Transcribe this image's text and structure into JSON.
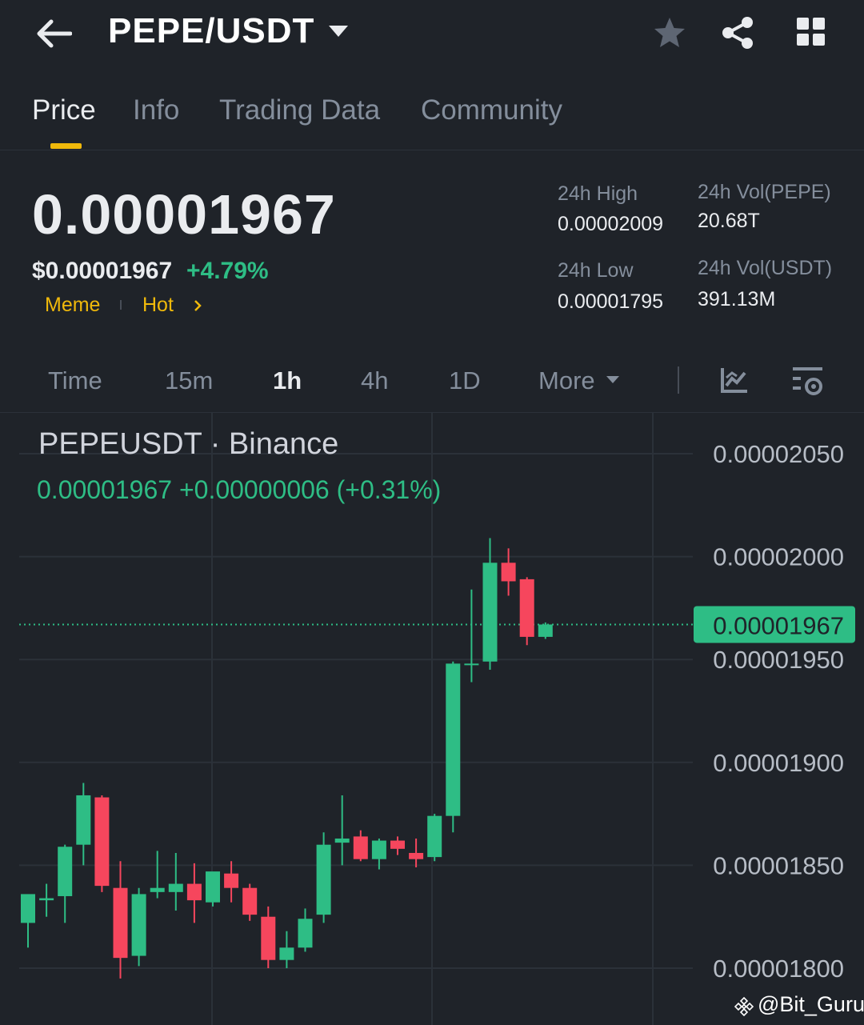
{
  "header": {
    "pair": "PEPE/USDT"
  },
  "tabs": [
    {
      "label": "Price"
    },
    {
      "label": "Info"
    },
    {
      "label": "Trading Data"
    },
    {
      "label": "Community"
    }
  ],
  "price": {
    "last": "0.00001967",
    "usd": "$0.00001967",
    "change_pct": "+4.79%",
    "tags": [
      "Meme",
      "Hot"
    ]
  },
  "stats": {
    "high_label": "24h High",
    "high_value": "0.00002009",
    "low_label": "24h Low",
    "low_value": "0.00001795",
    "vol_base_label": "24h Vol(PEPE)",
    "vol_base_value": "20.68T",
    "vol_quote_label": "24h Vol(USDT)",
    "vol_quote_value": "391.13M"
  },
  "intervals": [
    "Time",
    "15m",
    "1h",
    "4h",
    "1D",
    "More"
  ],
  "intervals_active": "1h",
  "chart": {
    "title": "PEPEUSDT · Binance",
    "ohlc_line": "0.00001967  +0.00000006 (+0.31%)"
  },
  "colors": {
    "up": "#2ebd85",
    "down": "#f6465d",
    "accent": "#f0b90b",
    "background": "#1f2329"
  },
  "icons": {
    "back": "arrow-left-icon",
    "caret": "caret-down-icon",
    "star": "star-icon",
    "share": "share-icon",
    "grid": "grid-icon",
    "indicator": "indicator-icon",
    "settings": "chart-settings-icon"
  },
  "watermark": "@Bit_Guru",
  "chart_data": {
    "type": "candlestick",
    "ylim": [
      1.795e-05,
      2.08e-05
    ],
    "y_ticks": [
      "0.00002050",
      "0.00002000",
      "0.00001950",
      "0.00001900",
      "0.00001850",
      "0.00001800"
    ],
    "current_price_label": "0.00001967",
    "current_price": 1.967e-05,
    "candles": [
      {
        "o": 1.822e-05,
        "h": 1.83e-05,
        "l": 1.81e-05,
        "c": 1.836e-05
      },
      {
        "o": 1.833e-05,
        "h": 1.841e-05,
        "l": 1.825e-05,
        "c": 1.834e-05
      },
      {
        "o": 1.835e-05,
        "h": 1.86e-05,
        "l": 1.822e-05,
        "c": 1.859e-05
      },
      {
        "o": 1.86e-05,
        "h": 1.89e-05,
        "l": 1.85e-05,
        "c": 1.884e-05
      },
      {
        "o": 1.883e-05,
        "h": 1.884e-05,
        "l": 1.837e-05,
        "c": 1.84e-05
      },
      {
        "o": 1.839e-05,
        "h": 1.852e-05,
        "l": 1.795e-05,
        "c": 1.805e-05
      },
      {
        "o": 1.806e-05,
        "h": 1.839e-05,
        "l": 1.801e-05,
        "c": 1.836e-05
      },
      {
        "o": 1.837e-05,
        "h": 1.857e-05,
        "l": 1.834e-05,
        "c": 1.839e-05
      },
      {
        "o": 1.837e-05,
        "h": 1.856e-05,
        "l": 1.828e-05,
        "c": 1.841e-05
      },
      {
        "o": 1.841e-05,
        "h": 1.851e-05,
        "l": 1.822e-05,
        "c": 1.833e-05
      },
      {
        "o": 1.832e-05,
        "h": 1.846e-05,
        "l": 1.83e-05,
        "c": 1.847e-05
      },
      {
        "o": 1.846e-05,
        "h": 1.852e-05,
        "l": 1.832e-05,
        "c": 1.839e-05
      },
      {
        "o": 1.839e-05,
        "h": 1.841e-05,
        "l": 1.823e-05,
        "c": 1.826e-05
      },
      {
        "o": 1.825e-05,
        "h": 1.83e-05,
        "l": 1.8e-05,
        "c": 1.804e-05
      },
      {
        "o": 1.804e-05,
        "h": 1.818e-05,
        "l": 1.8e-05,
        "c": 1.81e-05
      },
      {
        "o": 1.81e-05,
        "h": 1.829e-05,
        "l": 1.808e-05,
        "c": 1.824e-05
      },
      {
        "o": 1.826e-05,
        "h": 1.866e-05,
        "l": 1.822e-05,
        "c": 1.86e-05
      },
      {
        "o": 1.861e-05,
        "h": 1.884e-05,
        "l": 1.85e-05,
        "c": 1.863e-05
      },
      {
        "o": 1.864e-05,
        "h": 1.867e-05,
        "l": 1.852e-05,
        "c": 1.853e-05
      },
      {
        "o": 1.853e-05,
        "h": 1.863e-05,
        "l": 1.848e-05,
        "c": 1.862e-05
      },
      {
        "o": 1.862e-05,
        "h": 1.864e-05,
        "l": 1.855e-05,
        "c": 1.858e-05
      },
      {
        "o": 1.856e-05,
        "h": 1.863e-05,
        "l": 1.849e-05,
        "c": 1.853e-05
      },
      {
        "o": 1.854e-05,
        "h": 1.875e-05,
        "l": 1.852e-05,
        "c": 1.874e-05
      },
      {
        "o": 1.874e-05,
        "h": 1.949e-05,
        "l": 1.866e-05,
        "c": 1.948e-05
      },
      {
        "o": 1.948e-05,
        "h": 1.984e-05,
        "l": 1.939e-05,
        "c": 1.948e-05
      },
      {
        "o": 1.949e-05,
        "h": 2.009e-05,
        "l": 1.945e-05,
        "c": 1.997e-05
      },
      {
        "o": 1.997e-05,
        "h": 2.004e-05,
        "l": 1.981e-05,
        "c": 1.988e-05
      },
      {
        "o": 1.989e-05,
        "h": 1.99e-05,
        "l": 1.957e-05,
        "c": 1.961e-05
      },
      {
        "o": 1.961e-05,
        "h": 1.968e-05,
        "l": 1.96e-05,
        "c": 1.967e-05
      }
    ]
  }
}
